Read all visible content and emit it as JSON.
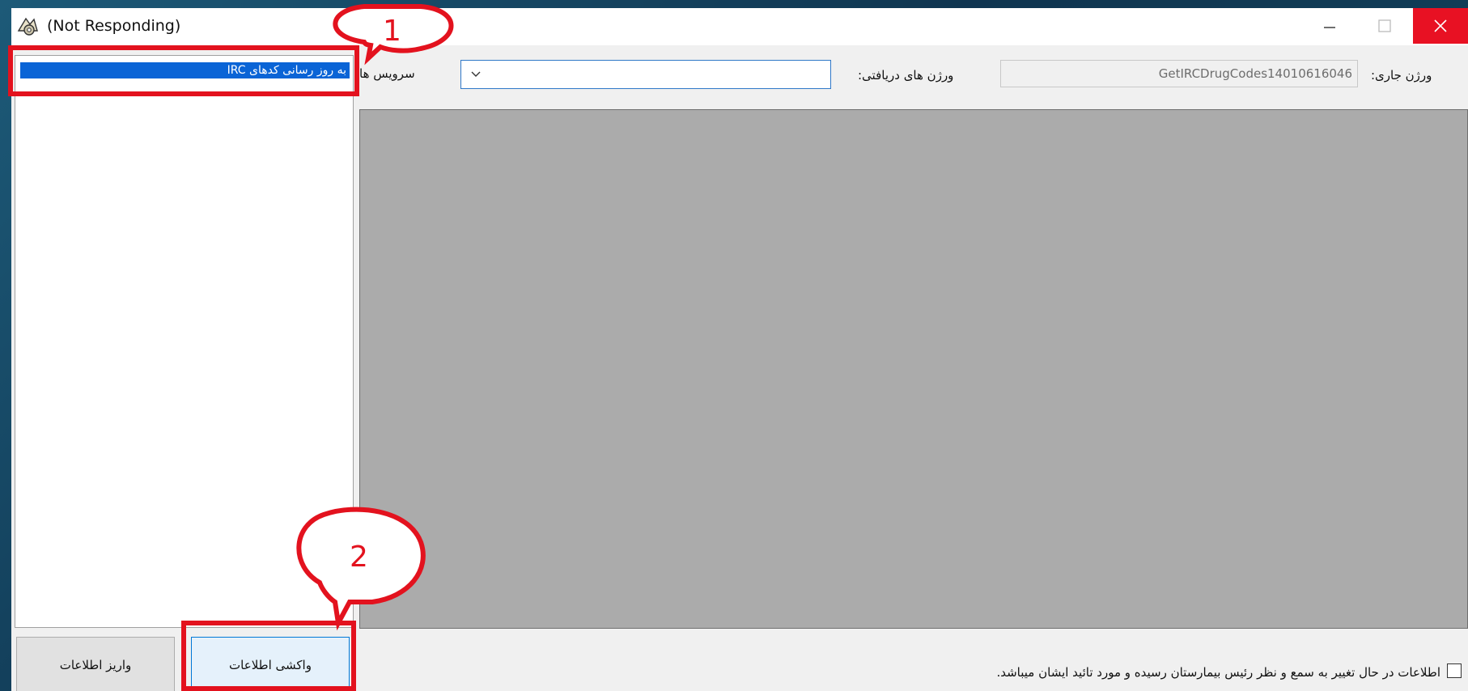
{
  "window": {
    "title": "(Not Responding)",
    "controls": {
      "minimize_icon": "minimize-icon",
      "maximize_icon": "maximize-icon",
      "close_icon": "close-icon",
      "close_color": "#e81123"
    }
  },
  "left_list": {
    "items": [
      {
        "label": "به روز رسانی کدهای IRC",
        "selected": true
      }
    ]
  },
  "header": {
    "current_version_label": "ورژن جاری:",
    "current_version_value": "GetIRCDrugCodes14010616046",
    "received_versions_label": "ورژن های دریافتی:",
    "service_label": "سرویس ها",
    "service_selected": ""
  },
  "footer": {
    "deposit_button": "واریز اطلاعات",
    "fetch_button": "واکشی اطلاعات",
    "notice": "اطلاعات در حال تغییر به سمع و نظر رئیس بیمارستان رسیده و مورد تائید ایشان میباشد.",
    "approval_checked": false
  },
  "annotations": [
    {
      "number": "1",
      "color": "#e3121e"
    },
    {
      "number": "2",
      "color": "#e3121e"
    }
  ]
}
